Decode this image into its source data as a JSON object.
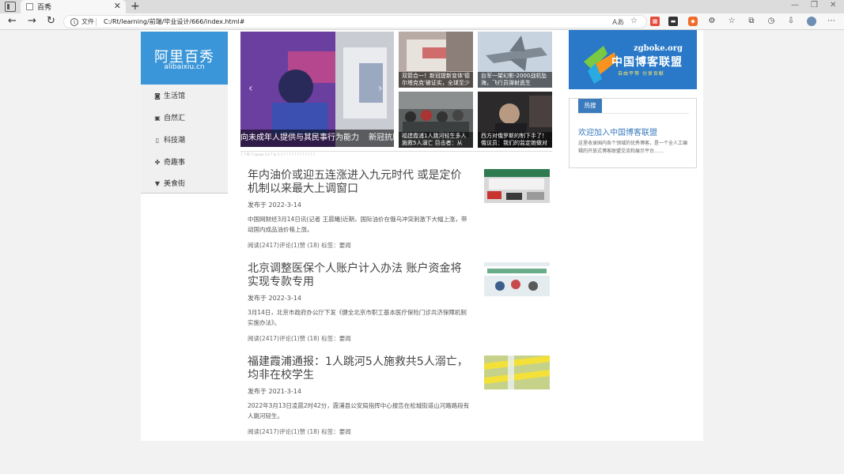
{
  "browser": {
    "tab_title": "百秀",
    "tab_close": "✕",
    "new_tab": "+",
    "back": "←",
    "forward": "→",
    "reload": "↻",
    "info": "i",
    "file_label": "文件",
    "url": "C:/Rt/learning/前端/毕业设计/666/index.html#",
    "read_aloud": "Aあ",
    "win_min": "—",
    "win_restore": "❐",
    "win_close": "✕"
  },
  "site": {
    "logo_cn": "阿里百秀",
    "logo_py": "alibaixiu.cn"
  },
  "menu": [
    {
      "icon": "camera-icon",
      "glyph": "◙",
      "label": "生活馆"
    },
    {
      "icon": "picture-icon",
      "glyph": "▣",
      "label": "自然汇"
    },
    {
      "icon": "phone-icon",
      "glyph": "▯",
      "label": "科技潮"
    },
    {
      "icon": "gamepad-icon",
      "glyph": "✤",
      "label": "奇趣事"
    },
    {
      "icon": "filter-icon",
      "glyph": "▼",
      "label": "美食街"
    }
  ],
  "slider": {
    "caption_1": "向未成年人提供与其民事行为能力",
    "caption_2": "新冠抗原",
    "prev": "‹",
    "next": "›"
  },
  "thumbs": [
    {
      "caption": "双箭合一！新冠提新变体'德尔塔克克'被证实，全球至少"
    },
    {
      "caption": "台军一架幻影-2000战机坠海，飞行员弹射逃生"
    },
    {
      "caption": "福建霞浦1人跳河轻生多人施救5人溺亡 目击者：从"
    },
    {
      "caption": "西方对俄罗斯的制下手了！俄议员：我们的监定她做对"
    }
  ],
  "divider_text": "7 7 fill 7 speak 3 4 ? to 1 1 ? ? ? ? ? ? ? ? ? ? ? ?",
  "articles": [
    {
      "title": "年内油价或迎五连涨进入九元时代 或是定价机制以来最大上调窗口",
      "date": "发布于 2022-3-14",
      "desc": "中国网财经3月14日讯(记者 王晨曦)近期，国际油价在俄乌冲突刺激下大幅上涨，带动国内成品油价格上涨。",
      "meta": "阅读(2417)评论(1)赞 (18) 标签：要闻"
    },
    {
      "title": "北京调整医保个人账户计入办法 账户资金将实现专款专用",
      "date": "发布于 2022-3-14",
      "desc": "3月14日，北京市政府办公厅下发《健全北京市职工基本医疗保险门诊共济保障机制实施办法》。",
      "meta": "阅读(2417)评论(1)赞 (18) 标签：要闻"
    },
    {
      "title": "福建霞浦通报：1人跳河5人施救共5人溺亡，均非在校学生",
      "date": "发布于 2021-3-14",
      "desc": "2022年3月13日凌晨2时42分，霞浦县公安局指挥中心报告在松城街道山河路路段有人跳河轻生。",
      "meta": "阅读(2417)评论(1)赞 (18) 标签：要闻"
    }
  ],
  "banner": {
    "url": "zgboke.org",
    "name": "中国博客联盟",
    "slogan": "自由平等  分享贡献"
  },
  "hot": {
    "tag": "热搜",
    "title": "欢迎加入中国博客联盟",
    "desc": "这里收录国内各个领域的优秀博客，是一个全人工编辑的开放式博客联盟交流和展示平台……"
  },
  "colors": {
    "accent": "#3a96d9",
    "hot_tag": "#3a7bbd",
    "banner": "#2979c8"
  }
}
